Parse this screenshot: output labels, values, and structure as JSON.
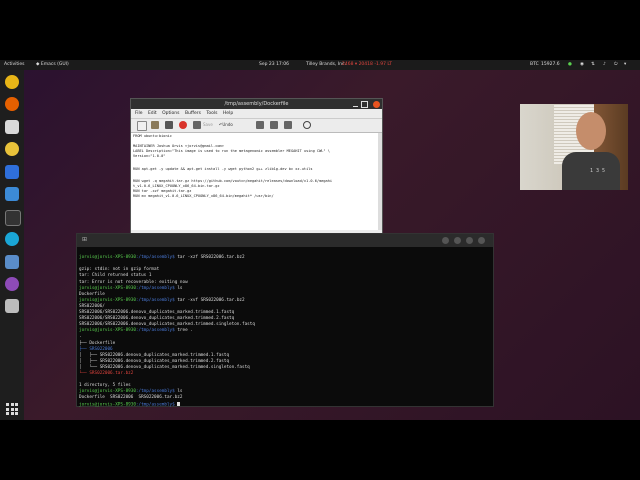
{
  "topbar": {
    "activities": "Activities",
    "app_menu": "Emacs (GUI)",
    "clock": "Sep 23  17:06",
    "ticker_1": "Tilley Brands, Inc.",
    "ticker_2": "2468  ▾ 20418  -1.97 LT",
    "btc_label": "BTC",
    "btc_value": "15927.6"
  },
  "emacs": {
    "title": "/tmp/assembly/Dockerfile",
    "menu": [
      "File",
      "Edit",
      "Options",
      "Buffers",
      "Tools",
      "Help"
    ],
    "toolbar_undo": "Undo",
    "toolbar_save": "Save",
    "lines": [
      "FROM ubuntu:bionic",
      "",
      "MAINTAINER Joshua Orvis <jorvis@gmail.com>",
      "LABEL Description=\"This image is used to run the metagenomic assembler MEGAHIT using CWL\" \\",
      "Version=\"1.0.0\"",
      "",
      "RUN apt-get -y update && apt-get install -y wget python2 g++ zlib1g-dev bc xz-utils",
      "",
      "RUN wget -q megahit.tar.gz https://github.com/voutcn/megahit/releases/download/v1.0.6/megahi",
      "t_v1.0.6_LINUX_CPUONLY_x86_64-bin.tar.gz",
      "RUN tar -xzf megahit.tar.gz",
      "RUN mv megahit_v1.0.6_LINUX_CPUONLY_x86_64-bin/megahit* /usr/bin/"
    ],
    "modeline": "-:---  Dockerfile      All L10    (Fundamental)",
    "echo": "Mark set"
  },
  "terminal": {
    "rows": [
      {
        "user": "",
        "path": "",
        "cmd": ""
      },
      {
        "user": "jorvis@jorvis-XPS-8930",
        "path": ":/tmp/assembly$",
        "cmd": " tar -xzf SRS022006.tar.bz2"
      },
      {
        "user": "",
        "path": "",
        "cmd": ""
      },
      {
        "user": "",
        "path": "",
        "cmd": "gzip: stdin: not in gzip format"
      },
      {
        "user": "",
        "path": "",
        "cmd": "tar: Child returned status 1"
      },
      {
        "user": "",
        "path": "",
        "cmd": "tar: Error is not recoverable: exiting now"
      },
      {
        "user": "jorvis@jorvis-XPS-8930",
        "path": ":/tmp/assembly$",
        "cmd": " ls"
      },
      {
        "user": "",
        "path": "",
        "cmd": "Dockerfile"
      },
      {
        "user": "jorvis@jorvis-XPS-8930",
        "path": ":/tmp/assembly$",
        "cmd": " tar -xvf SRS022006.tar.bz2"
      },
      {
        "user": "",
        "path": "",
        "cmd": "SRS022006/"
      },
      {
        "user": "",
        "path": "",
        "cmd": "SRS022006/SRS022006.denovo_duplicates_marked.trimmed.1.fastq"
      },
      {
        "user": "",
        "path": "",
        "cmd": "SRS022006/SRS022006.denovo_duplicates_marked.trimmed.2.fastq"
      },
      {
        "user": "",
        "path": "",
        "cmd": "SRS022006/SRS022006.denovo_duplicates_marked.trimmed.singleton.fastq"
      },
      {
        "user": "jorvis@jorvis-XPS-8930",
        "path": ":/tmp/assembly$",
        "cmd": " tree ."
      },
      {
        "user": "",
        "path": "",
        "cmd": "."
      },
      {
        "user": "",
        "path": "",
        "cmd": "├── Dockerfile"
      },
      {
        "user": "",
        "path": "",
        "cmd": "├── SRS022006",
        "cls": "pb"
      },
      {
        "user": "",
        "path": "",
        "cmd": "│   ├── SRS022006.denovo_duplicates_marked.trimmed.1.fastq"
      },
      {
        "user": "",
        "path": "",
        "cmd": "│   ├── SRS022006.denovo_duplicates_marked.trimmed.2.fastq"
      },
      {
        "user": "",
        "path": "",
        "cmd": "│   └── SRS022006.denovo_duplicates_marked.trimmed.singleton.fastq"
      },
      {
        "user": "",
        "path": "",
        "cmd": "└── SRS022006.tar.bz2",
        "cls": "pr"
      },
      {
        "user": "",
        "path": "",
        "cmd": ""
      },
      {
        "user": "",
        "path": "",
        "cmd": "1 directory, 5 files"
      },
      {
        "user": "jorvis@jorvis-XPS-8930",
        "path": ":/tmp/assembly$",
        "cmd": " ls"
      },
      {
        "user": "",
        "path": "",
        "cmd": "Dockerfile  SRS022006  SRS022006.tar.bz2"
      },
      {
        "user": "jorvis@jorvis-XPS-8930",
        "path": ":/tmp/assembly$",
        "cmd": " "
      }
    ]
  },
  "webcam": {
    "shirt_text": "1 3 5"
  }
}
